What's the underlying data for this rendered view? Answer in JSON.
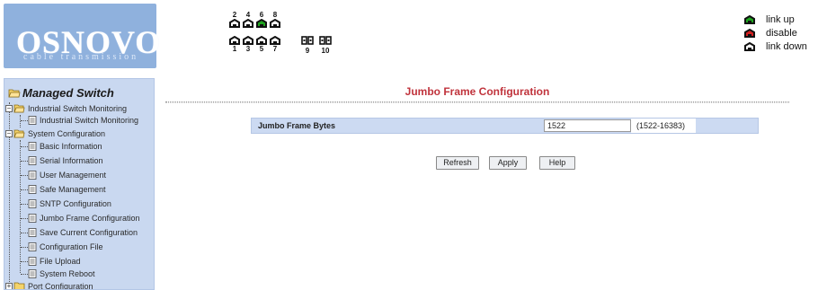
{
  "logo": {
    "title": "OSNOVO",
    "subtitle": "cable transmission"
  },
  "ports": {
    "top": [
      "2",
      "4",
      "6",
      "8"
    ],
    "bottom": [
      "1",
      "3",
      "5",
      "7"
    ],
    "sfp": [
      "9",
      "10"
    ],
    "states": {
      "1": "link down",
      "2": "link down",
      "3": "link down",
      "4": "link down",
      "5": "link down",
      "6": "link up",
      "7": "link down",
      "8": "link down",
      "9": "link down",
      "10": "link down"
    }
  },
  "legend": {
    "link_up": "link up",
    "disable": "disable",
    "link_down": "link down",
    "colors": {
      "link_up": "#1fa51f",
      "disable": "#d42020",
      "link_down": "#ffffff"
    }
  },
  "sidebar": {
    "root": "Managed Switch",
    "items": [
      {
        "label": "Industrial Switch Monitoring",
        "type": "folder"
      },
      {
        "label": "Industrial Switch Monitoring",
        "type": "page"
      },
      {
        "label": "System Configuration",
        "type": "folder"
      },
      {
        "label": "Basic Information",
        "type": "page"
      },
      {
        "label": "Serial Information",
        "type": "page"
      },
      {
        "label": "User Management",
        "type": "page"
      },
      {
        "label": "Safe Management",
        "type": "page"
      },
      {
        "label": "SNTP Configuration",
        "type": "page"
      },
      {
        "label": "Jumbo Frame Configuration",
        "type": "page"
      },
      {
        "label": "Save Current Configuration",
        "type": "page"
      },
      {
        "label": "Configuration File",
        "type": "page"
      },
      {
        "label": "File Upload",
        "type": "page"
      },
      {
        "label": "System Reboot",
        "type": "page"
      },
      {
        "label": "Port Configuration",
        "type": "folder"
      }
    ]
  },
  "main": {
    "title": "Jumbo Frame Configuration",
    "field_label": "Jumbo Frame Bytes",
    "field_value": "1522",
    "field_range": "(1522-16383)",
    "buttons": {
      "refresh": "Refresh",
      "apply": "Apply",
      "help": "Help"
    }
  },
  "colors": {
    "title_red": "#c0333c",
    "sidebar_bg": "#c9d8f0",
    "row_bg": "#ccdaf2",
    "logo_bg": "#8fb1dd"
  }
}
